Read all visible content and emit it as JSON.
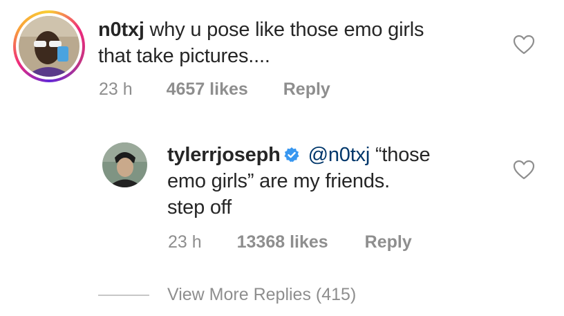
{
  "comment": {
    "username": "n0txj",
    "text_line1": " why u pose like those emo girls",
    "text_line2": "that take pictures....",
    "time": "23 h",
    "likes": "4657 likes",
    "reply_label": "Reply"
  },
  "reply": {
    "username": "tylerrjoseph",
    "mention": "@n0txj",
    "text_line1_rest": " “those",
    "text_line2": "emo girls” are my friends.",
    "text_line3": "step off",
    "time": "23 h",
    "likes": "13368 likes",
    "reply_label": "Reply"
  },
  "view_more": "View More Replies (415)",
  "colors": {
    "text": "#262626",
    "muted": "#8e8e8e",
    "verified": "#3897f0",
    "mention": "#00376b"
  },
  "icons": [
    "heart-outline-icon",
    "verified-badge-icon"
  ]
}
